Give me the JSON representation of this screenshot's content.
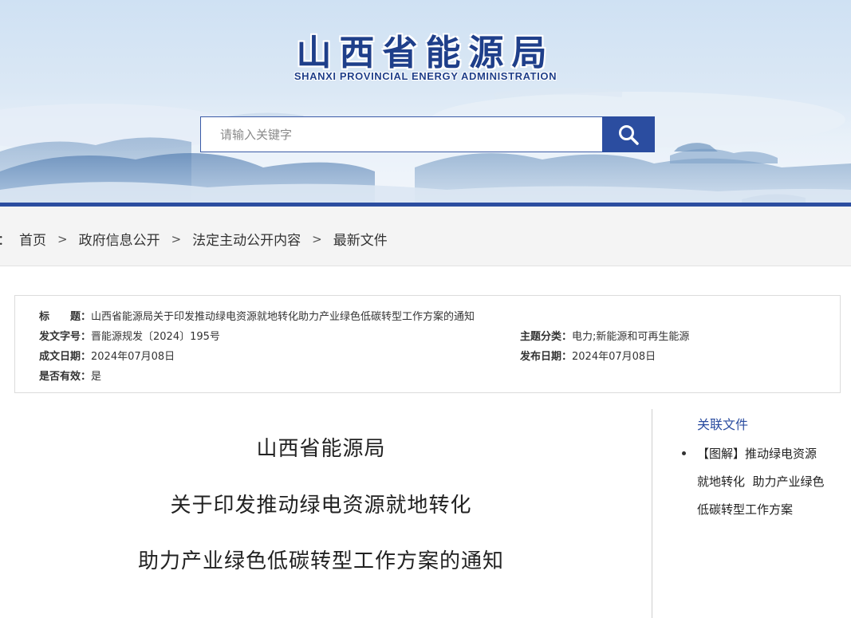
{
  "header": {
    "title_cn": "山西省能源局",
    "title_en": "SHANXI  PROVINCIAL  ENERGY ADMINISTRATION",
    "search_placeholder": "请输入关键字",
    "search_icon": "search-icon"
  },
  "breadcrumb": {
    "prefix": "置：",
    "items": [
      "首页",
      "政府信息公开",
      "法定主动公开内容",
      "最新文件"
    ],
    "separator": ">"
  },
  "meta": {
    "title_label": "标　　题：",
    "title_value": "山西省能源局关于印发推动绿电资源就地转化助力产业绿色低碳转型工作方案的通知",
    "doc_no_label": "发文字号：",
    "doc_no_value": "晋能源规发〔2024〕195号",
    "topic_label": "主题分类：",
    "topic_value": "电力;新能源和可再生能源",
    "created_label": "成文日期：",
    "created_value": "2024年07月08日",
    "published_label": "发布日期：",
    "published_value": "2024年07月08日",
    "valid_label": "是否有效：",
    "valid_value": "是"
  },
  "article": {
    "line1": "山西省能源局",
    "line2": "关于印发推动绿电资源就地转化",
    "line3": "助力产业绿色低碳转型工作方案的通知"
  },
  "related": {
    "title": "关联文件",
    "item_line1": "【图解】推动绿电资源",
    "item_line2": "就地转化  助力产业绿色",
    "item_line3": "低碳转型工作方案"
  },
  "colors": {
    "brand_blue": "#2b4da0",
    "title_blue": "#1f3f8a",
    "crumb_bg": "#f4f4f4"
  }
}
